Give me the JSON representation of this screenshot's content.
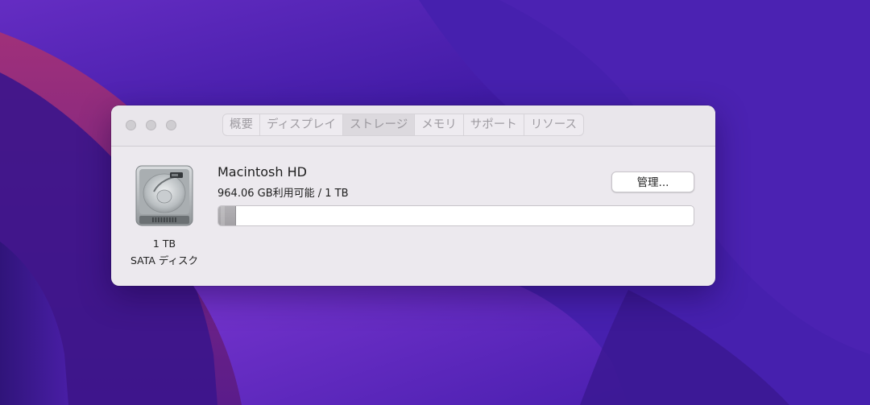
{
  "window": {
    "tabs": [
      {
        "label": "概要"
      },
      {
        "label": "ディスプレイ"
      },
      {
        "label": "ストレージ"
      },
      {
        "label": "メモリ"
      },
      {
        "label": "サポート"
      },
      {
        "label": "リソース"
      }
    ],
    "selected_tab": "ストレージ"
  },
  "disk": {
    "size_label": "1 TB",
    "type_label": "SATA ディスク",
    "icon": "hard-drive-icon"
  },
  "volume": {
    "name": "Macintosh HD",
    "availability": "964.06 GB利用可能 / 1 TB",
    "used_fraction": 0.036
  },
  "actions": {
    "manage_label": "管理..."
  },
  "colors": {
    "window_bg": "#ece9ee",
    "storage_used": "#a8a6aa",
    "wallpaper_base": "#4a1fb0"
  }
}
